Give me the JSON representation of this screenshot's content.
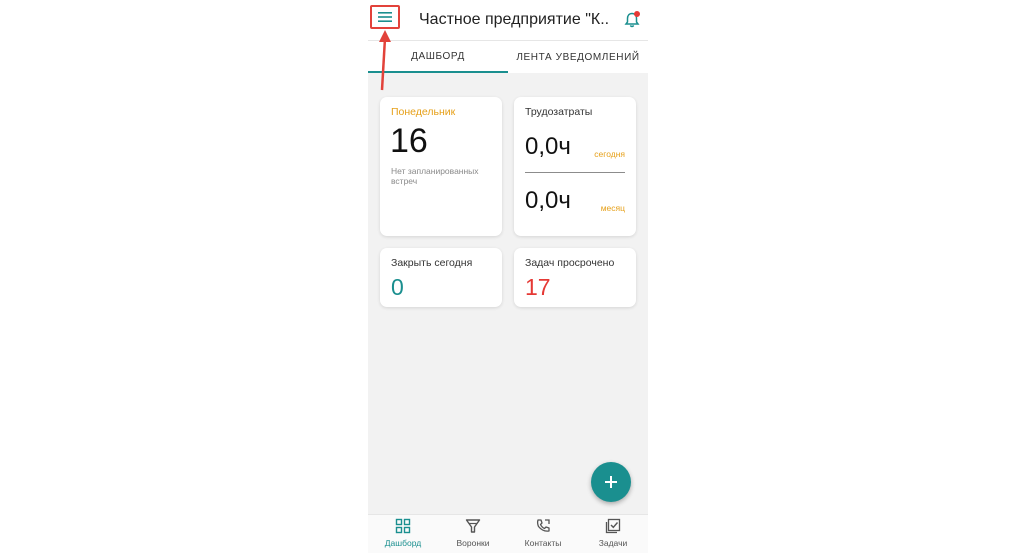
{
  "header": {
    "title": "Частное предприятие \"К...",
    "menu_icon": "hamburger-menu-icon",
    "notification_icon": "bell-icon"
  },
  "tabs": [
    {
      "label": "ДАШБОРД",
      "active": true
    },
    {
      "label": "ЛЕНТА УВЕДОМЛЕНИЙ",
      "active": false
    }
  ],
  "cards": {
    "day": {
      "weekday": "Понедельник",
      "date": "16",
      "note": "Нет запланированных встреч"
    },
    "labor": {
      "title": "Трудозатраты",
      "today_value": "0,0ч",
      "today_caption": "сегодня",
      "month_value": "0,0ч",
      "month_caption": "месяц"
    },
    "close_today": {
      "title": "Закрыть сегодня",
      "value": "0"
    },
    "overdue": {
      "title": "Задач просрочено",
      "value": "17"
    }
  },
  "fab": {
    "icon": "plus-icon"
  },
  "bottom_nav": [
    {
      "label": "Дашборд",
      "icon": "grid-icon",
      "active": true
    },
    {
      "label": "Воронки",
      "icon": "funnel-icon",
      "active": false
    },
    {
      "label": "Контакты",
      "icon": "phone-contacts-icon",
      "active": false
    },
    {
      "label": "Задачи",
      "icon": "checkbox-tasks-icon",
      "active": false
    }
  ],
  "colors": {
    "accent": "#1a8f8f",
    "highlight": "#e6a019",
    "alert": "#e53935",
    "annotation": "#e2423a"
  }
}
